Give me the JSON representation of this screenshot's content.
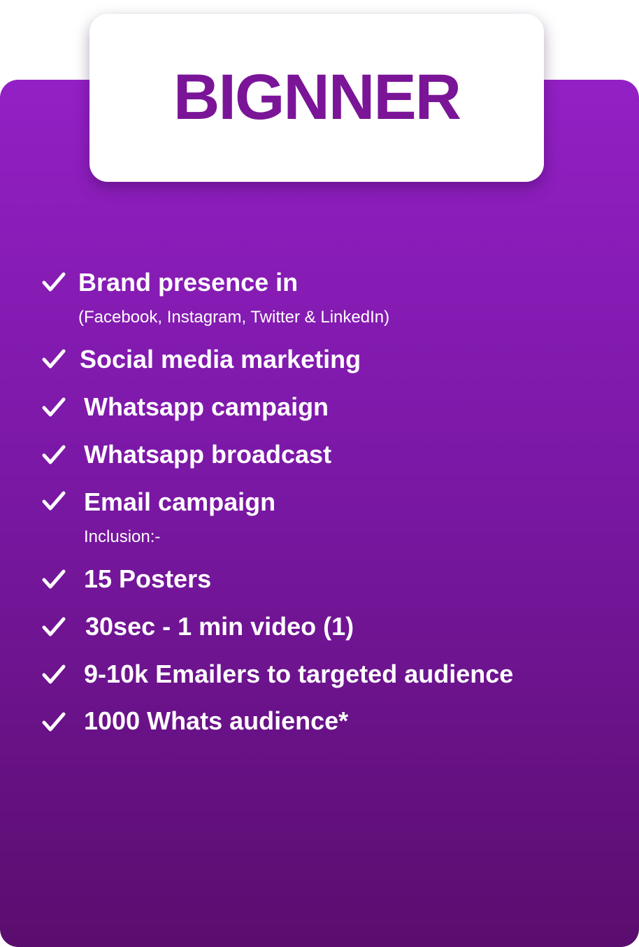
{
  "plan": {
    "title": "BIGNNER",
    "accent_color": "#7a1597",
    "card_gradient": [
      "#9320c4",
      "#5a0d6e"
    ]
  },
  "features": [
    {
      "label": "Brand presence in",
      "sub": "(Facebook, Instagram, Twitter & LinkedIn)",
      "icon": "checkmark-icon"
    },
    {
      "label": "Social media marketing",
      "icon": "checkmark-icon"
    },
    {
      "label": "Whatsapp campaign",
      "icon": "checkmark-icon"
    },
    {
      "label": "Whatsapp broadcast",
      "icon": "checkmark-icon"
    },
    {
      "label": "Email campaign",
      "sub": "Inclusion:-",
      "icon": "checkmark-icon"
    },
    {
      "label": "15 Posters",
      "icon": "checkmark-icon"
    },
    {
      "label": "30sec - 1 min video (1)",
      "icon": "checkmark-icon"
    },
    {
      "label": "9-10k Emailers to targeted audience",
      "icon": "checkmark-icon"
    },
    {
      "label": "1000 Whats audience*",
      "icon": "checkmark-icon"
    }
  ]
}
